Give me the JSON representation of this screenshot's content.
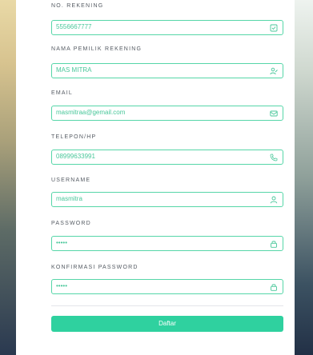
{
  "form": {
    "fields": [
      {
        "label": "NO. REKENING",
        "value": "5556667777",
        "icon": "document-check-icon"
      },
      {
        "label": "NAMA PEMILIK REKENING",
        "value": "MAS MITRA",
        "icon": "user-edit-icon"
      },
      {
        "label": "EMAIL",
        "value": "masmitraa@gemail.com",
        "icon": "mail-icon"
      },
      {
        "label": "TELEPON/HP",
        "value": "08999633991",
        "icon": "phone-icon"
      },
      {
        "label": "USERNAME",
        "value": "masmitra",
        "icon": "user-icon"
      },
      {
        "label": "PASSWORD",
        "value": "•••••",
        "icon": "lock-icon"
      },
      {
        "label": "KONFIRMASI PASSWORD",
        "value": "•••••",
        "icon": "lock-icon"
      }
    ],
    "submit_label": "Daftar"
  },
  "colors": {
    "accent": "#2fd19f",
    "input_border": "#56d6a8",
    "input_text": "#49c79a"
  }
}
